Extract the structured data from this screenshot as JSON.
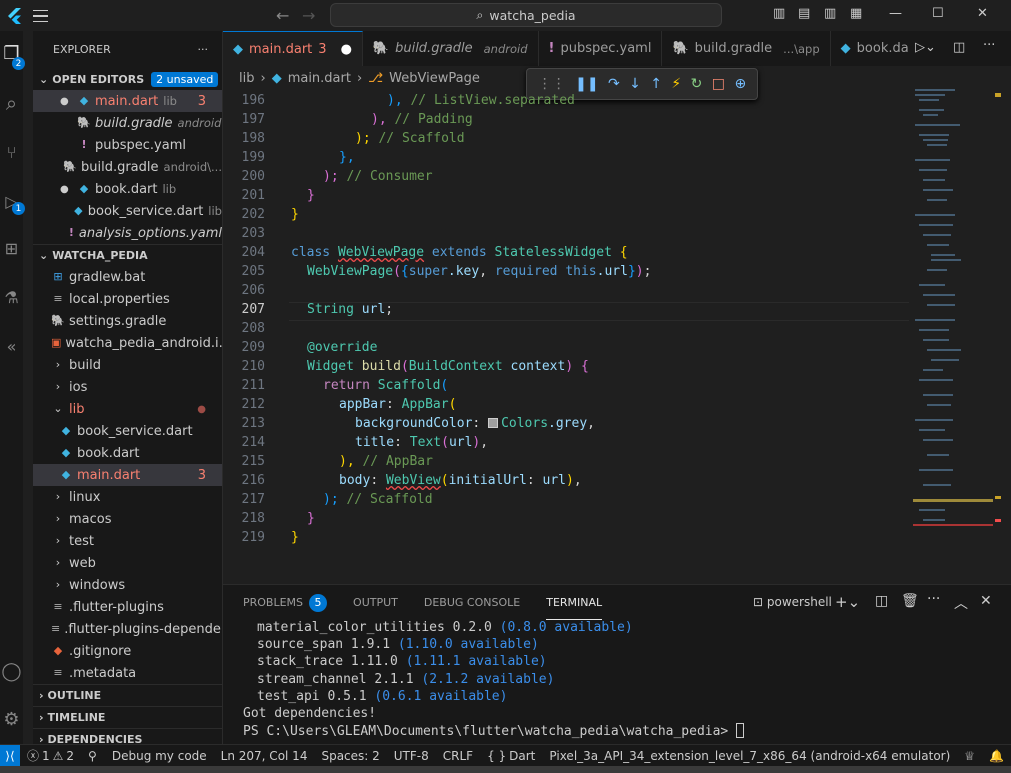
{
  "title_bar": {
    "search_text": "watcha_pedia"
  },
  "activity": {
    "explorer_badge": "2",
    "debug_badge": "1"
  },
  "sidebar": {
    "header": "EXPLORER",
    "more": "···",
    "open_editors": {
      "label": "OPEN EDITORS",
      "badge": "2 unsaved"
    },
    "open_files": [
      {
        "name": "main.dart",
        "desc": "lib",
        "problems": "3",
        "dot": true
      },
      {
        "name": "build.gradle",
        "desc": "android",
        "italic": true
      },
      {
        "name": "pubspec.yaml"
      },
      {
        "name": "build.gradle",
        "desc": "android\\..."
      },
      {
        "name": "book.dart",
        "desc": "lib",
        "dot": true
      },
      {
        "name": "book_service.dart",
        "desc": "lib"
      },
      {
        "name": "analysis_options.yaml",
        "italic": true
      }
    ],
    "project": {
      "label": "WATCHA_PEDIA"
    },
    "tree": [
      {
        "name": "gradlew.bat"
      },
      {
        "name": "local.properties"
      },
      {
        "name": "settings.gradle"
      },
      {
        "name": "watcha_pedia_android.i..."
      },
      {
        "name": "build"
      },
      {
        "name": "ios"
      },
      {
        "name": "lib"
      },
      {
        "name": "book_service.dart"
      },
      {
        "name": "book.dart"
      },
      {
        "name": "main.dart",
        "problems": "3"
      },
      {
        "name": "linux"
      },
      {
        "name": "macos"
      },
      {
        "name": "test"
      },
      {
        "name": "web"
      },
      {
        "name": "windows"
      },
      {
        "name": ".flutter-plugins"
      },
      {
        "name": ".flutter-plugins-depende..."
      },
      {
        "name": ".gitignore"
      },
      {
        "name": ".metadata"
      }
    ],
    "outline": "OUTLINE",
    "timeline": "TIMELINE",
    "dependencies": "DEPENDENCIES"
  },
  "tabs": [
    {
      "label": "main.dart",
      "problems": "3",
      "dirty": "●"
    },
    {
      "label": "build.gradle",
      "desc": "android"
    },
    {
      "label": "pubspec.yaml"
    },
    {
      "label": "build.gradle",
      "desc": "...\\app"
    },
    {
      "label": "book.da"
    }
  ],
  "breadcrumb": {
    "folder": "lib",
    "file": "main.dart",
    "symbol": "WebViewPage"
  },
  "code": {
    "line_numbers": [
      "196",
      "197",
      "198",
      "199",
      "200",
      "201",
      "202",
      "203",
      "204",
      "205",
      "206",
      "207",
      "208",
      "209",
      "210",
      "211",
      "212",
      "213",
      "214",
      "215",
      "216",
      "217",
      "218",
      "219"
    ],
    "current_line": "207",
    "t196a": "),",
    "t196b": "// ListView.separated",
    "t197a": "),",
    "t197b": "// Padding",
    "t198a": ");",
    "t198b": "// Scaffold",
    "t199": "},",
    "t200a": ");",
    "t200b": "// Consumer",
    "t201": "}",
    "t202": "}",
    "t204_class": "class",
    "t204_name": "WebViewPage",
    "t204_ext": "extends",
    "t204_base": "StatelessWidget",
    "t204_brace": "{",
    "t205_ctor": "WebViewPage",
    "t205_super": "super",
    "t205_key": ".key",
    "t205_req": "required",
    "t205_this": "this",
    "t205_url": ".url",
    "t207_type": "String",
    "t207_var": "url",
    "t209": "@override",
    "t210_type": "Widget",
    "t210_fn": "build",
    "t210_ptype": "BuildContext",
    "t210_param": "context",
    "t211_ret": "return",
    "t211_cls": "Scaffold",
    "t212_prop": "appBar",
    "t212_cls": "AppBar",
    "t213_prop": "backgroundColor",
    "t213_cls": "Colors",
    "t213_val": ".grey",
    "t214_prop": "title",
    "t214_cls": "Text",
    "t214_arg": "url",
    "t215a": "),",
    "t215b": "// AppBar",
    "t216_prop": "body",
    "t216_cls": "WebView",
    "t216_named": "initialUrl",
    "t216_arg": "url",
    "t217a": ");",
    "t217b": "// Scaffold",
    "t218": "}",
    "t219": "}"
  },
  "panel": {
    "tabs": [
      "PROBLEMS",
      "OUTPUT",
      "DEBUG CONSOLE",
      "TERMINAL"
    ],
    "problems_count": "5",
    "terminal_name": "powershell",
    "lines": [
      {
        "pkg": "material_color_utilities 0.2.0",
        "avail": "(0.8.0 available)"
      },
      {
        "pkg": "source_span 1.9.1",
        "avail": "(1.10.0 available)"
      },
      {
        "pkg": "stack_trace 1.11.0",
        "avail": "(1.11.1 available)"
      },
      {
        "pkg": "stream_channel 2.1.1",
        "avail": "(2.1.2 available)"
      },
      {
        "pkg": "test_api 0.5.1",
        "avail": "(0.6.1 available)"
      }
    ],
    "done": "Got dependencies!",
    "prompt": "PS C:\\Users\\GLEAM\\Documents\\flutter\\watcha_pedia\\watcha_pedia> "
  },
  "status": {
    "errors": "1",
    "warnings": "2",
    "debug": "Debug my code",
    "position": "Ln 207, Col 14",
    "spaces": "Spaces: 2",
    "encoding": "UTF-8",
    "eol": "CRLF",
    "lang": "Dart",
    "device": "Pixel_3a_API_34_extension_level_7_x86_64 (android-x64 emulator)"
  }
}
